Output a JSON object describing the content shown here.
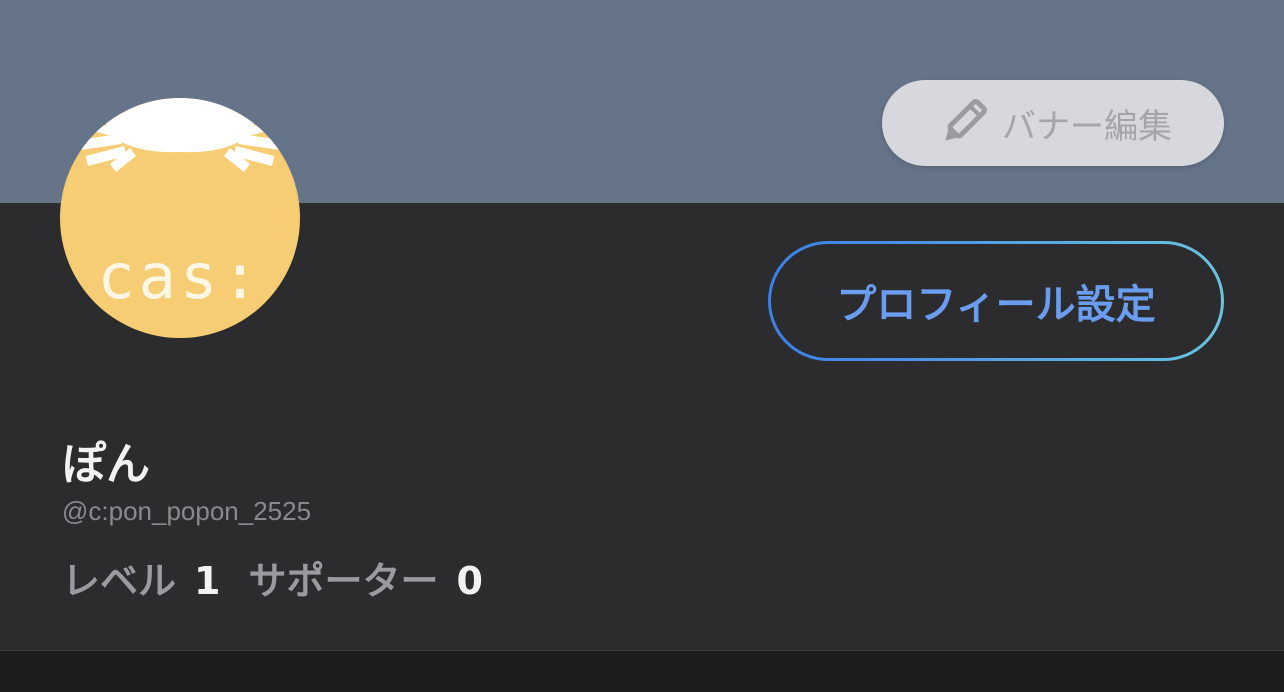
{
  "banner": {
    "edit_label": "バナー編集",
    "edit_icon": "pencil-icon"
  },
  "avatar": {
    "text": "cas:"
  },
  "profile_settings_label": "プロフィール設定",
  "user": {
    "name": "ぽん",
    "handle": "@c:pon_popon_2525"
  },
  "stats": {
    "level_label": "レベル",
    "level_value": "1",
    "supporter_label": "サポーター",
    "supporter_value": "0"
  },
  "colors": {
    "banner": "#667489",
    "background": "#2c2c2e",
    "avatar": "#f6cd74",
    "accent_start": "#3b7fe8",
    "accent_end": "#6ac4e0"
  }
}
